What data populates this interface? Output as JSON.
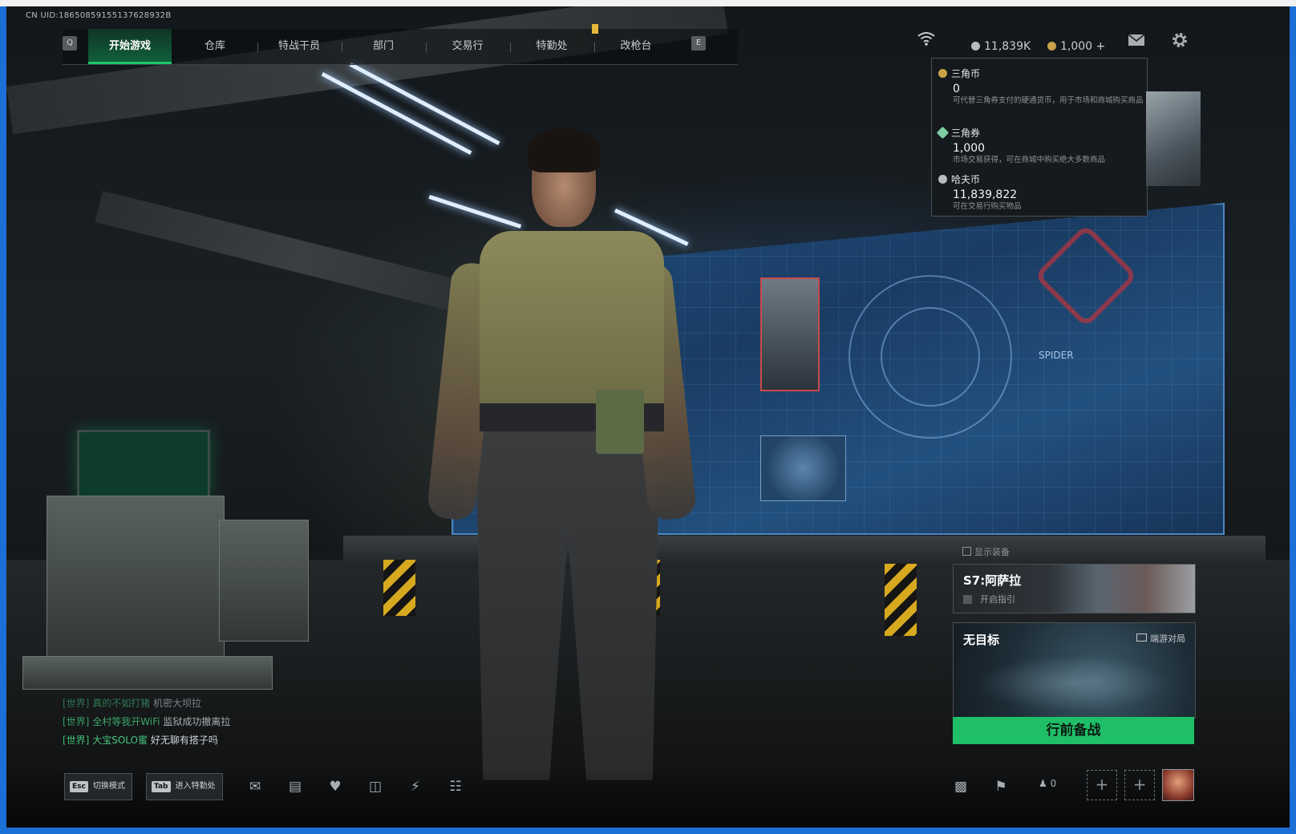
{
  "uid": "CN UID:18650859155137628932B",
  "nav": {
    "key_left": "Q",
    "key_right": "E",
    "tabs": [
      {
        "label": "开始游戏",
        "active": true
      },
      {
        "label": "仓库",
        "active": false
      },
      {
        "label": "特战干员",
        "active": false
      },
      {
        "label": "部门",
        "active": false
      },
      {
        "label": "交易行",
        "active": false
      },
      {
        "label": "特勤处",
        "active": false
      },
      {
        "label": "改枪台",
        "active": false
      }
    ]
  },
  "top_right": {
    "wifi_icon": "wifi-icon",
    "havoc_coin": "11,839K",
    "triangle_coupon": "1,000 +",
    "mail_icon": "mail-icon",
    "settings_icon": "gear-icon"
  },
  "currency_popup": {
    "items": [
      {
        "name": "三角币",
        "value": "0",
        "desc": "可代替三角券支付的硬通货币，用于市场和商城购买商品",
        "color": "#c9a24a"
      },
      {
        "name": "三角券",
        "value": "1,000",
        "desc": "市场交易获得，可在商城中购买绝大多数商品",
        "color": "#7ccfa3"
      },
      {
        "name": "哈夫币",
        "value": "11,839,822",
        "desc": "可在交易行购买物品",
        "color": "#b7bcc0"
      }
    ]
  },
  "scene": {
    "screen_label": "SPIDER"
  },
  "right_panel": {
    "show_gear": "显示装备",
    "season_title": "S7:阿萨拉",
    "season_sub": "开启指引",
    "mode_title": "无目标",
    "mode_tag": "端游对局",
    "deploy_label": "行前备战"
  },
  "chat": [
    {
      "channel": "[世界]",
      "name": "真的不如打猪",
      "msg": "机密大坝拉"
    },
    {
      "channel": "[世界]",
      "name": "全村等我开WiFi",
      "msg": "监狱成功撤离拉"
    },
    {
      "channel": "[世界]",
      "name": "大宝SOLO蜜",
      "msg": "好无聊有搭子吗"
    }
  ],
  "bottom": {
    "hotkeys": [
      {
        "key": "Esc",
        "label": "切换模式"
      },
      {
        "key": "Tab",
        "label": "进入特勤处"
      }
    ],
    "party_count": "0",
    "add_slot": "+"
  },
  "colors": {
    "accent_green": "#1fbf68",
    "frame_blue": "#1b6fd6"
  }
}
